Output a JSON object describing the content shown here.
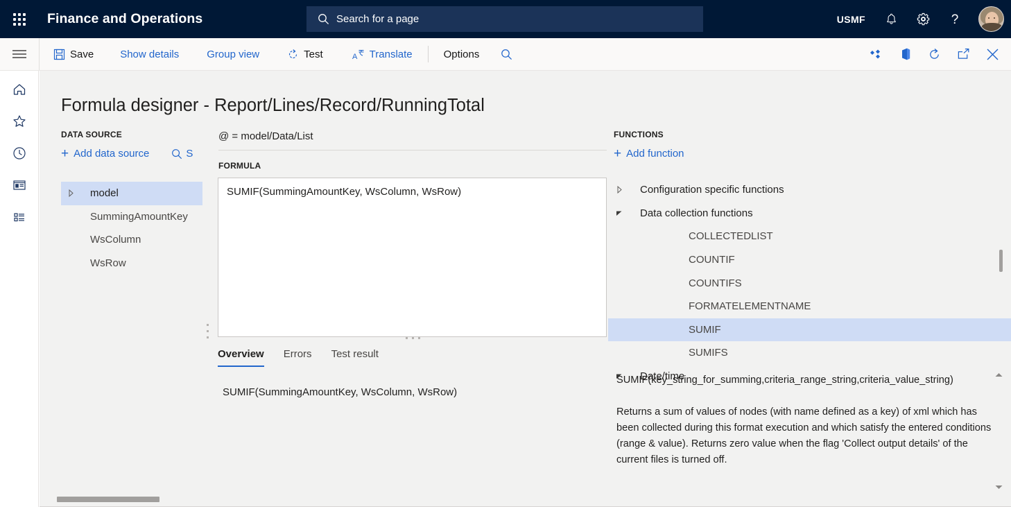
{
  "header": {
    "app_title": "Finance and Operations",
    "waffle_icon": "app-launcher-icon",
    "search_placeholder": "Search for a page",
    "search_icon": "search-icon",
    "company": "USMF",
    "notification_icon": "bell-icon",
    "settings_icon": "gear-icon",
    "help_icon": "question-mark-icon",
    "avatar_icon": "user-avatar"
  },
  "command_bar": {
    "hamburger_icon": "hamburger-menu-icon",
    "buttons": [
      {
        "label": "Save",
        "icon": "save-floppy-icon",
        "style": "dark"
      },
      {
        "label": "Show details",
        "icon": "",
        "style": "link"
      },
      {
        "label": "Group view",
        "icon": "",
        "style": "link"
      },
      {
        "label": "Test",
        "icon": "test-refresh-icon",
        "style": "dark"
      },
      {
        "label": "Translate",
        "icon": "translate-icon",
        "style": "link"
      },
      {
        "label": "Options",
        "icon": "",
        "style": "dark"
      }
    ],
    "search_icon": "search-icon",
    "right_icons": [
      "personalize-diamond-icon",
      "office-app-icon",
      "refresh-icon",
      "open-in-new-window-icon",
      "close-icon"
    ]
  },
  "nav_rail": {
    "items": [
      "hamburger-menu-icon",
      "home-icon",
      "favorites-star-icon",
      "recent-clock-icon",
      "workspaces-icon",
      "modules-list-icon"
    ]
  },
  "page": {
    "title": "Formula designer - Report/Lines/Record/RunningTotal"
  },
  "data_source": {
    "section_label": "DATA SOURCE",
    "add_label": "Add data source",
    "add_icon": "plus-icon",
    "search_icon": "search-icon",
    "search_label": "S",
    "tree": [
      {
        "label": "model",
        "level": 0,
        "expandable": true,
        "caret": "collapsed-caret-icon",
        "selected": true
      },
      {
        "label": "SummingAmountKey",
        "level": 1,
        "expandable": false,
        "caret": "",
        "selected": false
      },
      {
        "label": "WsColumn",
        "level": 1,
        "expandable": false,
        "caret": "",
        "selected": false
      },
      {
        "label": "WsRow",
        "level": 1,
        "expandable": false,
        "caret": "",
        "selected": false
      }
    ]
  },
  "formula_panel": {
    "binding": "@ = model/Data/List",
    "formula_label": "FORMULA",
    "formula_value": "SUMIF(SummingAmountKey, WsColumn, WsRow)",
    "tabs": [
      {
        "label": "Overview",
        "active": true
      },
      {
        "label": "Errors",
        "active": false
      },
      {
        "label": "Test result",
        "active": false
      }
    ],
    "overview_text": "SUMIF(SummingAmountKey, WsColumn, WsRow)"
  },
  "functions_panel": {
    "section_label": "FUNCTIONS",
    "add_label": "Add function",
    "add_icon": "plus-icon",
    "tree": [
      {
        "label": "Configuration specific functions",
        "type": "group",
        "expanded": false,
        "caret": "collapsed-caret-icon",
        "selected": false
      },
      {
        "label": "Data collection functions",
        "type": "group",
        "expanded": true,
        "caret": "expanded-caret-icon",
        "selected": false
      },
      {
        "label": "COLLECTEDLIST",
        "type": "leaf",
        "selected": false
      },
      {
        "label": "COUNTIF",
        "type": "leaf",
        "selected": false
      },
      {
        "label": "COUNTIFS",
        "type": "leaf",
        "selected": false
      },
      {
        "label": "FORMATELEMENTNAME",
        "type": "leaf",
        "selected": false
      },
      {
        "label": "SUMIF",
        "type": "leaf",
        "selected": true
      },
      {
        "label": "SUMIFS",
        "type": "leaf",
        "selected": false
      },
      {
        "label": "Date/time",
        "type": "group",
        "expanded": true,
        "caret": "expanded-caret-icon",
        "selected": false
      }
    ],
    "description_signature": "SUMIF(key_string_for_summing,criteria_range_string,criteria_value_string)",
    "description_body": "Returns a sum of values of nodes (with name defined as a key) of xml which has been collected during this format execution and which satisfy the entered conditions (range & value). Returns zero value when the flag 'Collect output details' of the current files is turned off.",
    "scroll_up_icon": "chevron-up-icon",
    "scroll_down_icon": "chevron-down-icon"
  },
  "colors": {
    "header_bg": "#001836",
    "accent_link": "#2266cc",
    "selection_bg": "#cfdcf5",
    "content_bg": "#f2f2f1",
    "command_bar_bg": "#faf9f8"
  }
}
